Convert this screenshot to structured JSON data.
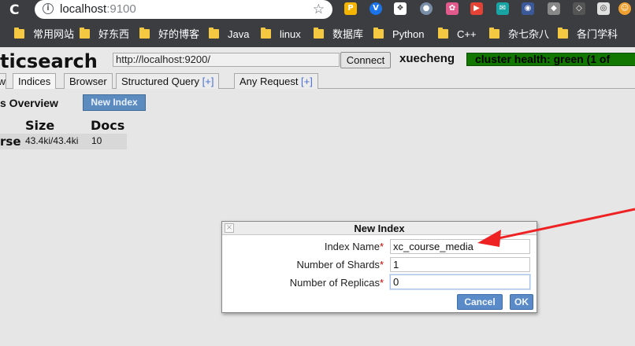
{
  "browser": {
    "url_host": "localhost",
    "url_port": ":9100",
    "bookmarks": [
      "常用网站",
      "好东西",
      "好的博客",
      "Java",
      "linux",
      "数据库",
      "Python",
      "C++",
      "杂七杂八",
      "各门学科"
    ],
    "extension_icons": [
      "pocket-icon",
      "vpn-icon",
      "extension-icon",
      "extension-icon",
      "extension-icon",
      "extension-icon",
      "extension-icon",
      "extension-icon",
      "extension-icon",
      "extension-icon",
      "extension-icon",
      "avatar-icon"
    ]
  },
  "app": {
    "title": "ticsearch",
    "connect_url": "http://localhost:9200/",
    "connect_label": "Connect",
    "cluster_name": "xuecheng",
    "health_text": "cluster health: green (1 of",
    "colors": {
      "health": "#117700",
      "accent_button": "#5a8bc8",
      "required": "#cc0000"
    }
  },
  "tabs": [
    {
      "label": "w",
      "suffix": ""
    },
    {
      "label": "Indices",
      "suffix": ""
    },
    {
      "label": "Browser",
      "suffix": ""
    },
    {
      "label": "Structured Query ",
      "suffix": "[+]"
    },
    {
      "label": "Any Request ",
      "suffix": "[+]"
    }
  ],
  "overview": {
    "title": "s Overview",
    "new_index_label": "New Index",
    "columns": [
      "Size",
      "Docs"
    ],
    "rows": [
      {
        "name": "rse",
        "size": "43.4ki/43.4ki",
        "docs": "10"
      }
    ]
  },
  "dialog": {
    "title": "New Index",
    "close_glyph": "×",
    "fields": [
      {
        "label": "Index Name",
        "required": "*",
        "value": "xc_course_media"
      },
      {
        "label": "Number of Shards",
        "required": "*",
        "value": "1"
      },
      {
        "label": "Number of Replicas",
        "required": "*",
        "value": "0"
      }
    ],
    "cancel_label": "Cancel",
    "ok_label": "OK"
  }
}
